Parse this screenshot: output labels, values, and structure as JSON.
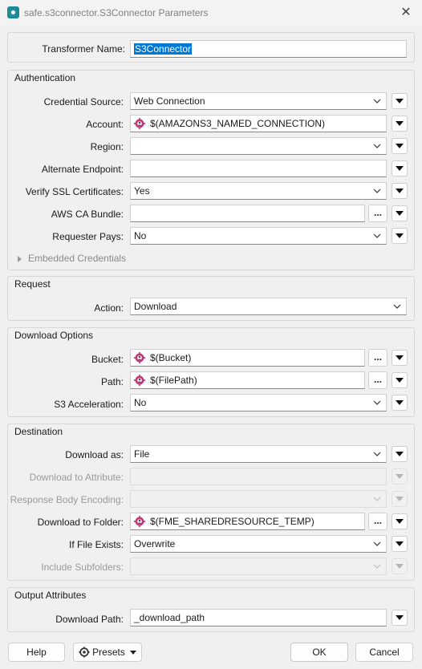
{
  "window": {
    "title": "safe.s3connector.S3Connector Parameters",
    "close_glyph": "✕"
  },
  "transformer": {
    "label": "Transformer Name:",
    "value": "S3Connector"
  },
  "authentication": {
    "title": "Authentication",
    "credential_source": {
      "label": "Credential Source:",
      "value": "Web Connection"
    },
    "account": {
      "label": "Account:",
      "value": "$(AMAZONS3_NAMED_CONNECTION)"
    },
    "region": {
      "label": "Region:",
      "value": ""
    },
    "alternate_endpoint": {
      "label": "Alternate Endpoint:",
      "value": ""
    },
    "verify_ssl": {
      "label": "Verify SSL Certificates:",
      "value": "Yes"
    },
    "aws_ca_bundle": {
      "label": "AWS CA Bundle:",
      "value": ""
    },
    "requester_pays": {
      "label": "Requester Pays:",
      "value": "No"
    },
    "embedded_credentials": "Embedded Credentials"
  },
  "request": {
    "title": "Request",
    "action": {
      "label": "Action:",
      "value": "Download"
    }
  },
  "download_options": {
    "title": "Download Options",
    "bucket": {
      "label": "Bucket:",
      "value": "$(Bucket)"
    },
    "path": {
      "label": "Path:",
      "value": "$(FilePath)"
    },
    "s3_acceleration": {
      "label": "S3 Acceleration:",
      "value": "No"
    }
  },
  "destination": {
    "title": "Destination",
    "download_as": {
      "label": "Download as:",
      "value": "File"
    },
    "download_to_attribute": {
      "label": "Download to Attribute:",
      "value": ""
    },
    "response_body_encoding": {
      "label": "Response Body Encoding:",
      "value": ""
    },
    "download_to_folder": {
      "label": "Download to Folder:",
      "value": "$(FME_SHAREDRESOURCE_TEMP)"
    },
    "if_file_exists": {
      "label": "If File Exists:",
      "value": "Overwrite"
    },
    "include_subfolders": {
      "label": "Include Subfolders:",
      "value": ""
    }
  },
  "output_attributes": {
    "title": "Output Attributes",
    "download_path": {
      "label": "Download Path:",
      "value": "_download_path"
    }
  },
  "footer": {
    "help": "Help",
    "presets": "Presets",
    "ok": "OK",
    "cancel": "Cancel"
  },
  "dots_glyph": "...",
  "icons": {
    "app": "fme-app-icon",
    "gear": "user-parameter-gear-icon",
    "menu": "triangle-down-icon",
    "chevron": "chevron-down-icon",
    "expander": "triangle-right-icon"
  },
  "colors": {
    "selection": "#0078d4",
    "gear_body": "#d24a8a",
    "app_icon": "#1a8a99"
  }
}
